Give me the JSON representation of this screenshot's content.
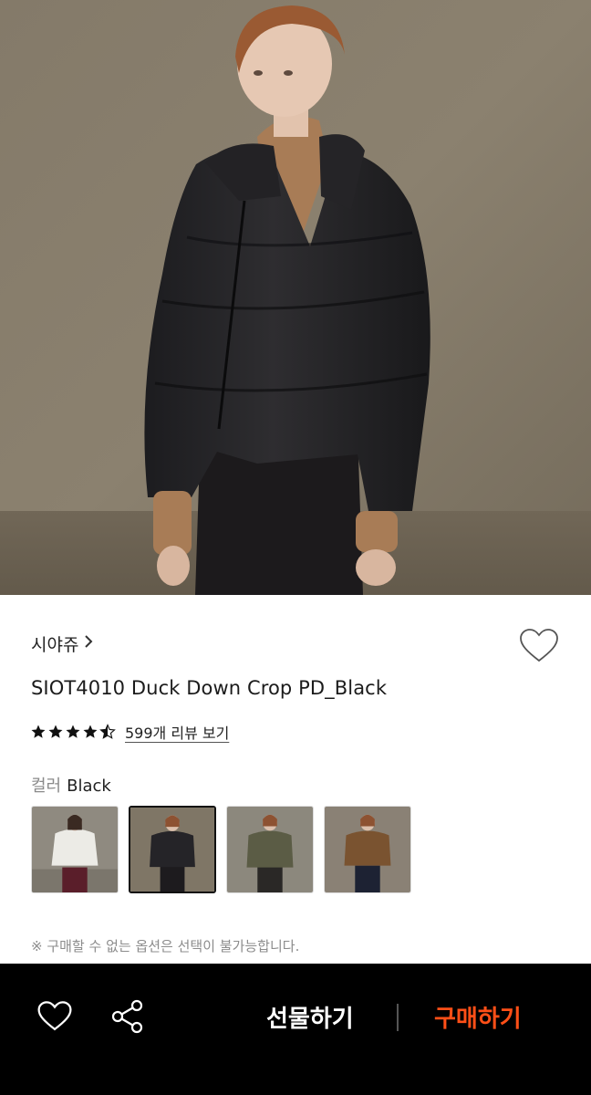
{
  "product": {
    "brand": "시야쥬",
    "title": "SIOT4010 Duck Down Crop PD_Black",
    "rating": 4.5,
    "reviews_label": "599개 리뷰 보기",
    "color_key": "컬러",
    "color_value": "Black",
    "selected_swatch": 1,
    "swatches": [
      "ivory",
      "black",
      "khaki",
      "camel"
    ],
    "notice": "※ 구매할 수 없는 옵션은 선택이 불가능합니다."
  },
  "icons": {
    "brand_chevron": "chevron-right-icon",
    "wishlist": "heart-outline-icon",
    "bottom_heart": "heart-outline-icon",
    "share": "share-icon"
  },
  "actions": {
    "gift_label": "선물하기",
    "buy_label": "구매하기"
  },
  "colors": {
    "accent": "#ff4f17",
    "bottom_bar": "#000000"
  }
}
